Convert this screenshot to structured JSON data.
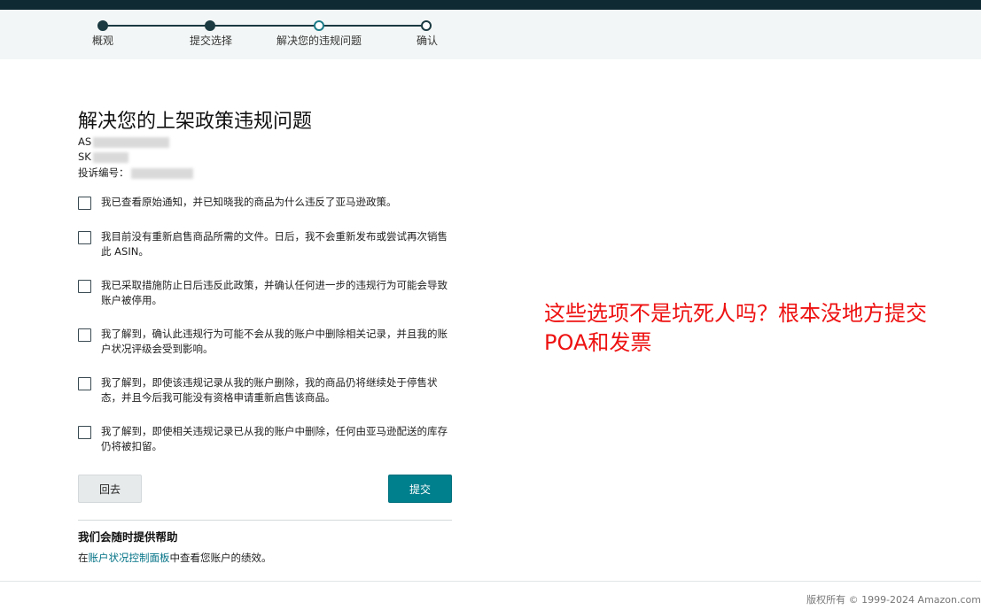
{
  "stepper": {
    "steps": [
      {
        "label": "概观",
        "state": "done"
      },
      {
        "label": "提交选择",
        "state": "done"
      },
      {
        "label": "解决您的违规问题",
        "state": "current"
      },
      {
        "label": "确认",
        "state": "todo"
      }
    ]
  },
  "main": {
    "title": "解决您的上架政策违规问题",
    "asin_label": "AS",
    "sku_label": "SK",
    "complaint_label": "投诉编号：",
    "checklist": [
      "我已查看原始通知，并已知晓我的商品为什么违反了亚马逊政策。",
      "我目前没有重新启售商品所需的文件。日后，我不会重新发布或尝试再次销售此 ASIN。",
      "我已采取措施防止日后违反此政策，并确认任何进一步的违规行为可能会导致账户被停用。",
      "我了解到，确认此违规行为可能不会从我的账户中删除相关记录，并且我的账户状况评级会受到影响。",
      "我了解到，即使该违规记录从我的账户删除，我的商品仍将继续处于停售状态，并且今后我可能没有资格申请重新启售该商品。",
      "我了解到，即使相关违规记录已从我的账户中删除，任何由亚马逊配送的库存仍将被扣留。"
    ],
    "back_label": "回去",
    "submit_label": "提交",
    "help_title": "我们会随时提供帮助",
    "help_prefix": "在",
    "help_link": "账户状况控制面板",
    "help_suffix": "中查看您账户的绩效。"
  },
  "annotation": {
    "line1": "这些选项不是坑死人吗？根本没地方提交",
    "line2": "POA和发票"
  },
  "footer": {
    "copyright": "版权所有 © 1999-2024 Amazon.com"
  },
  "colors": {
    "top_bar": "#0f2a33",
    "accent": "#007f8d",
    "annotation": "#ee1111"
  }
}
